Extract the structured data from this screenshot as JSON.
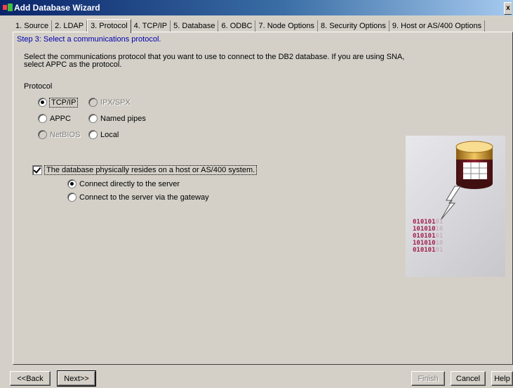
{
  "window": {
    "title": "Add Database Wizard",
    "close_glyph": "x"
  },
  "tabs": [
    {
      "label": "1. Source"
    },
    {
      "label": "2. LDAP"
    },
    {
      "label": "3. Protocol",
      "active": true
    },
    {
      "label": "4. TCP/IP"
    },
    {
      "label": "5. Database"
    },
    {
      "label": "6. ODBC"
    },
    {
      "label": "7. Node Options"
    },
    {
      "label": "8. Security Options"
    },
    {
      "label": "9. Host or AS/400 Options"
    }
  ],
  "step_label": "Step 3: Select a communications protocol.",
  "description": "Select the communications protocol that you want to use to connect to the DB2 database.   If you are using SNA, select APPC as the protocol.",
  "protocol": {
    "label": "Protocol",
    "options": [
      {
        "label": "TCP/IP",
        "checked": true,
        "disabled": false
      },
      {
        "label": "IPX/SPX",
        "checked": false,
        "disabled": true
      },
      {
        "label": "APPC",
        "checked": false,
        "disabled": false
      },
      {
        "label": "Named pipes",
        "checked": false,
        "disabled": false
      },
      {
        "label": "NetBIOS",
        "checked": false,
        "disabled": true
      },
      {
        "label": "Local",
        "checked": false,
        "disabled": false
      }
    ]
  },
  "host_check": {
    "label": "The database physically resides on a host or AS/400 system.",
    "checked": true
  },
  "connect_options": [
    {
      "label": "Connect directly to the server",
      "checked": true
    },
    {
      "label": "Connect to the server via the gateway",
      "checked": false
    }
  ],
  "illustration": {
    "binary_rows": [
      "01010101",
      "10101010",
      "01010101",
      "10101010",
      "01010101"
    ],
    "bright_color": "#a0204a",
    "faint_color": "#c8b0b8"
  },
  "buttons": {
    "back": "<<Back",
    "next": "Next>>",
    "finish": "Finish",
    "cancel": "Cancel",
    "help": "Help"
  }
}
